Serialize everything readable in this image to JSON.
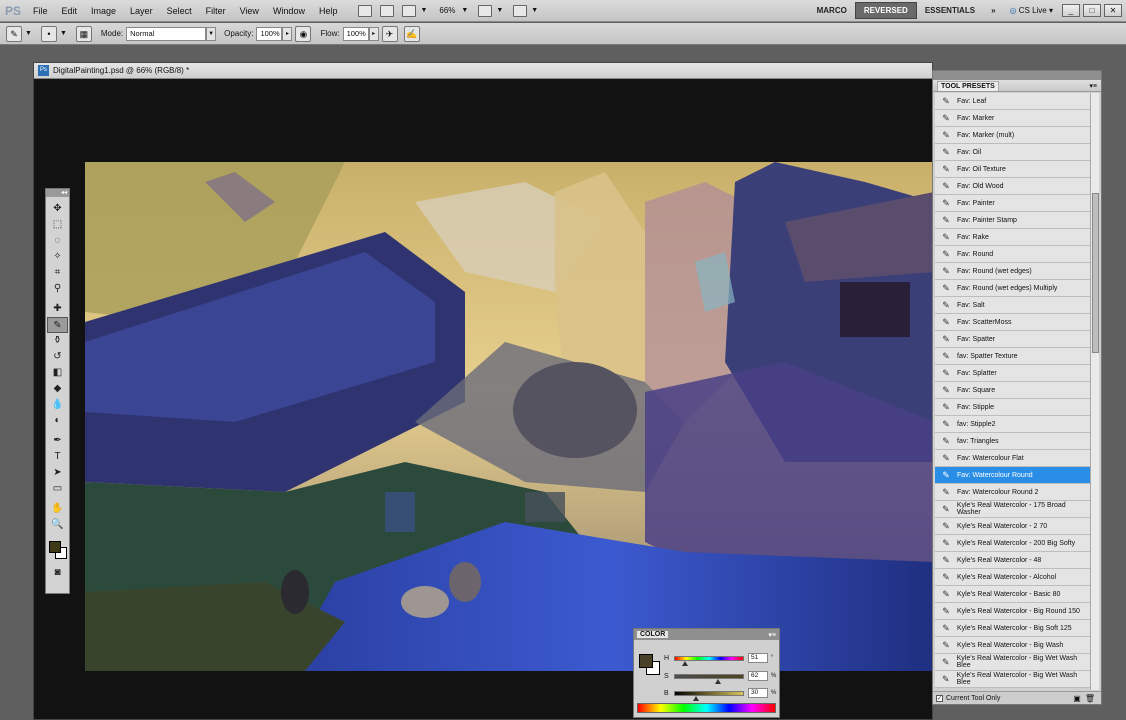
{
  "app": {
    "logo": "PS"
  },
  "menu": [
    "File",
    "Edit",
    "Image",
    "Layer",
    "Select",
    "Filter",
    "View",
    "Window",
    "Help"
  ],
  "menubar": {
    "zoom": "66%",
    "workspaces": [
      "MARCO",
      "REVERSED",
      "ESSENTIALS"
    ],
    "active_workspace": "REVERSED",
    "more": "»",
    "cslive": "CS Live"
  },
  "options": {
    "mode_label": "Mode:",
    "mode_value": "Normal",
    "opacity_label": "Opacity:",
    "opacity_value": "100%",
    "flow_label": "Flow:",
    "flow_value": "100%"
  },
  "document": {
    "title": "DigitalPainting1.psd @ 66% (RGB/8) *",
    "icon": "Ps"
  },
  "tool_presets": {
    "title": "TOOL PRESETS",
    "items": [
      "Fav: Leaf",
      "Fav: Marker",
      "Fav: Marker (mult)",
      "Fav: Oil",
      "Fav: Oil Texture",
      "Fav: Old Wood",
      "Fav: Painter",
      "Fav: Painter Stamp",
      "Fav: Rake",
      "Fav: Round",
      "Fav: Round (wet edges)",
      "Fav: Round (wet edges) Multiply",
      "Fav: Salt",
      "Fav: ScatterMoss",
      "Fav: Spatter",
      "fav: Spatter Texture",
      "Fav: Splatter",
      "Fav: Square",
      "Fav: Stipple",
      "fav: Stipple2",
      "fav: Triangles",
      "Fav: Watercolour Flat",
      "Fav: Watercolour Round",
      "Fav: Watercolour Round 2",
      "Kyle's Real Watercolor - 175 Broad Washer",
      "Kyle's Real Watercolor - 2 70",
      "Kyle's Real Watercolor - 200 Big Softy",
      "Kyle's Real Watercolor - 48",
      "Kyle's Real Watercolor - Alcohol",
      "Kyle's Real Watercolor - Basic 80",
      "Kyle's Real Watercolor - Big Round 150",
      "Kyle's Real Watercolor - Big Soft 125",
      "Kyle's Real Watercolor - Big Wash",
      "Kyle's Real Watercolor - Big Wet Wash Blee",
      "Kyle's Real Watercolor - Big Wet Wash Blee"
    ],
    "selected": "Fav: Watercolour Round",
    "footer_label": "Current Tool Only",
    "footer_checked": "✓"
  },
  "color_panel": {
    "title": "COLOR",
    "fg_color": "#4a4228",
    "h_label": "H",
    "h_value": "51",
    "h_unit": "°",
    "s_label": "S",
    "s_value": "62",
    "s_unit": "%",
    "b_label": "B",
    "b_value": "30",
    "b_unit": "%",
    "h_fraction": 0.14,
    "s_fraction": 0.62,
    "b_fraction": 0.3
  },
  "toolbox": {
    "fg_color": "#3e3a18"
  }
}
